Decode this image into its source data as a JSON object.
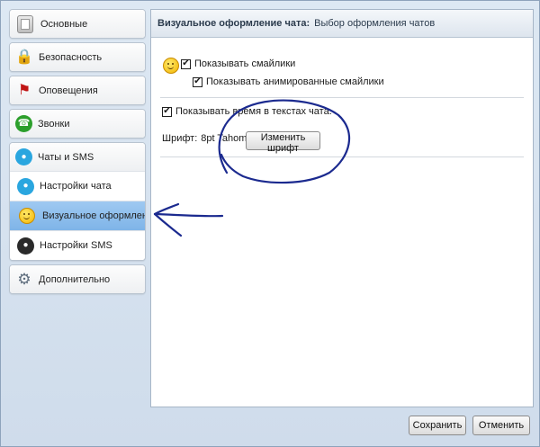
{
  "sidebar": {
    "general": "Основные",
    "security": "Безопасность",
    "notifications": "Оповещения",
    "calls": "Звонки",
    "chats": {
      "label": "Чаты и SMS",
      "items": [
        "Настройки чата",
        "Визуальное оформлен...",
        "Настройки SMS"
      ]
    },
    "advanced": "Дополнительно"
  },
  "header": {
    "title": "Визуальное оформление чата:",
    "subtitle": "Выбор оформления чатов"
  },
  "options": {
    "show_emoticons": {
      "label": "Показывать смайлики",
      "checked": true
    },
    "show_animated": {
      "label": "Показывать анимированные смайлики",
      "checked": true
    },
    "show_time": {
      "label": "Показывать время в текстах чата.",
      "checked": true
    }
  },
  "font": {
    "label": "Шрифт:",
    "value": "8pt Tahoma",
    "change_button": "Изменить шрифт"
  },
  "footer": {
    "save": "Сохранить",
    "cancel": "Отменить"
  },
  "colors": {
    "annotation_ink": "#1b2a8f",
    "selected_item": "#8dbdec"
  },
  "icons": {
    "general": "general-settings-icon",
    "security": "lock-icon",
    "notifications": "flag-icon",
    "calls": "phone-icon",
    "chats": "chat-bubble-icon",
    "chat_settings": "chat-bubble-icon",
    "visual": "smiley-icon",
    "sms": "sms-icon",
    "advanced": "gear-icon",
    "emoticons": "smiley-icon"
  }
}
